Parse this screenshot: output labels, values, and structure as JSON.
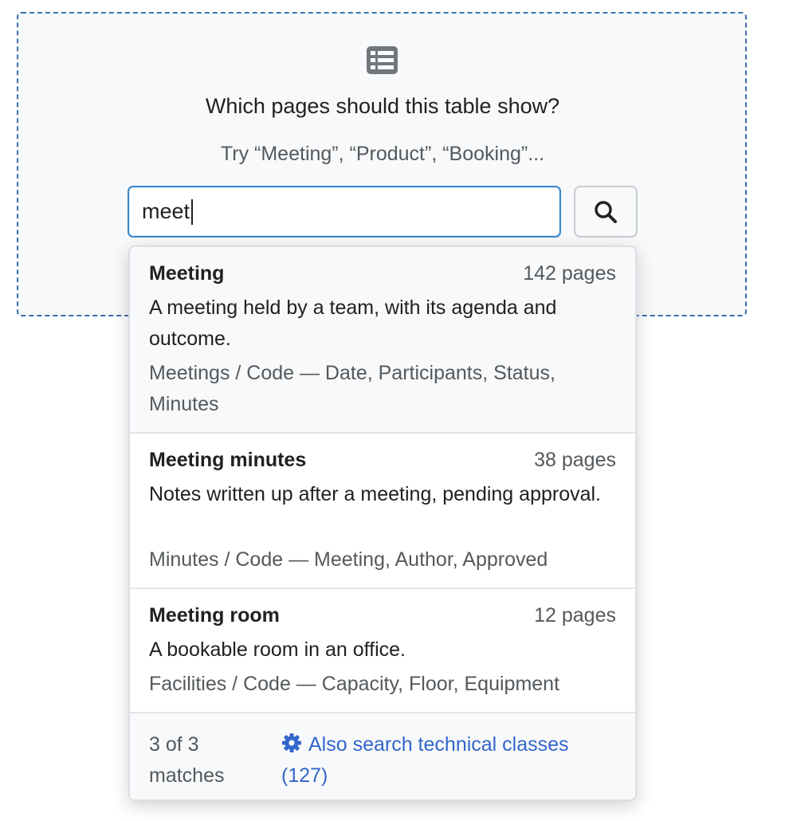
{
  "panel": {
    "icon": "table-list-icon",
    "title": "Which pages should this table show?",
    "hint": "Try “Meeting”, “Product”, “Booking”..."
  },
  "search": {
    "value": "meet",
    "button_icon": "search-icon"
  },
  "results": [
    {
      "name": "Meeting",
      "count": "142 pages",
      "description": "A meeting held by a team, with its agenda and outcome.",
      "meta": "Meetings / Code — Date, Participants, Status, Minutes"
    },
    {
      "name": "Meeting minutes",
      "count": "38 pages",
      "description": "Notes written up after a meeting, pending approval.",
      "meta": "Minutes / Code — Meeting, Author, Approved"
    },
    {
      "name": "Meeting room",
      "count": "12 pages",
      "description": "A bookable room in an office.",
      "meta": "Facilities / Code — Capacity, Floor, Equipment"
    }
  ],
  "footer": {
    "match_count": "3 of 3 matches",
    "tech_link": "Also search technical classes (127)",
    "tech_icon": "gear-icon"
  },
  "colors": {
    "accent": "#3366cc",
    "panel_border": "#3a6fa8",
    "input_border": "#3a87c9"
  }
}
